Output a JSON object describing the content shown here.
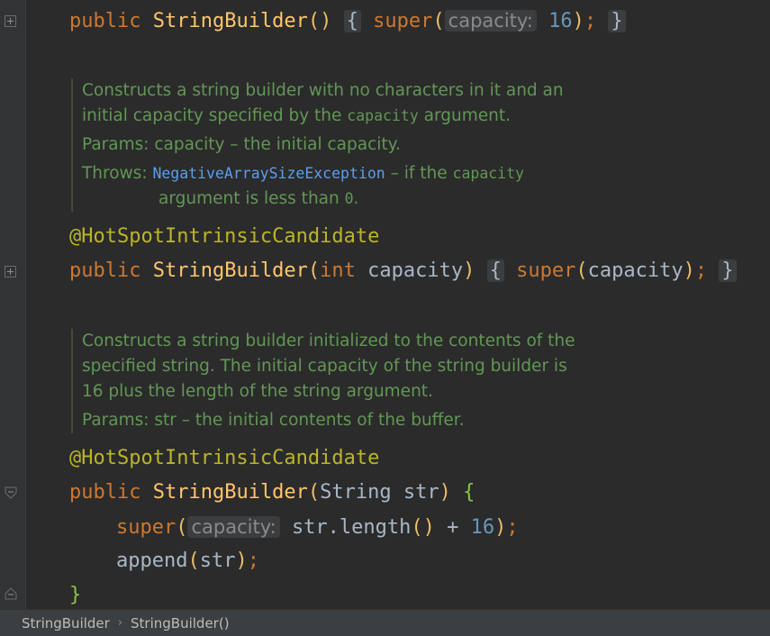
{
  "colors": {
    "keyword": "#cc7832",
    "method": "#ffc66d",
    "annotation": "#bbb529",
    "number": "#6897bb",
    "doc_comment": "#629755",
    "doc_link": "#5e9ded",
    "background": "#2b2b2b"
  },
  "code": {
    "ctor1": {
      "kw": "public",
      "name": "StringBuilder",
      "body_kw": "super",
      "hint": "capacity:",
      "arg": "16"
    },
    "doc1": {
      "line1": "Constructs a string builder with no characters in it and an",
      "line2_a": "initial capacity specified by the ",
      "line2_code": "capacity",
      "line2_b": " argument.",
      "params_label": "Params:",
      "params_text": "capacity – the initial capacity.",
      "throws_label": "Throws:",
      "throws_link": "NegativeArraySizeException",
      "throws_text_a": " – if the ",
      "throws_code": "capacity",
      "throws_text_b": "argument is less than ",
      "throws_code2": "0",
      "throws_text_c": "."
    },
    "ann1": "@HotSpotIntrinsicCandidate",
    "ctor2": {
      "kw": "public",
      "name": "StringBuilder",
      "type": "int",
      "param": "capacity",
      "body_kw": "super",
      "arg": "capacity"
    },
    "doc2": {
      "line1": "Constructs a string builder initialized to the contents of the",
      "line2": "specified string. The initial capacity of the string builder is",
      "line3": "16 plus the length of the string argument.",
      "params_label": "Params:",
      "params_text": "str – the initial contents of the buffer."
    },
    "ann2": "@HotSpotIntrinsicCandidate",
    "ctor3": {
      "kw": "public",
      "name": "StringBuilder",
      "type": "String",
      "param": "str"
    },
    "line_super": {
      "kw": "super",
      "hint": "capacity:",
      "expr": "str.length",
      "op": "+",
      "num": "16"
    },
    "line_append": {
      "fn": "append",
      "arg": "str"
    },
    "close_brace": "}"
  },
  "breadcrumb": {
    "items": [
      "StringBuilder",
      "StringBuilder()"
    ]
  }
}
